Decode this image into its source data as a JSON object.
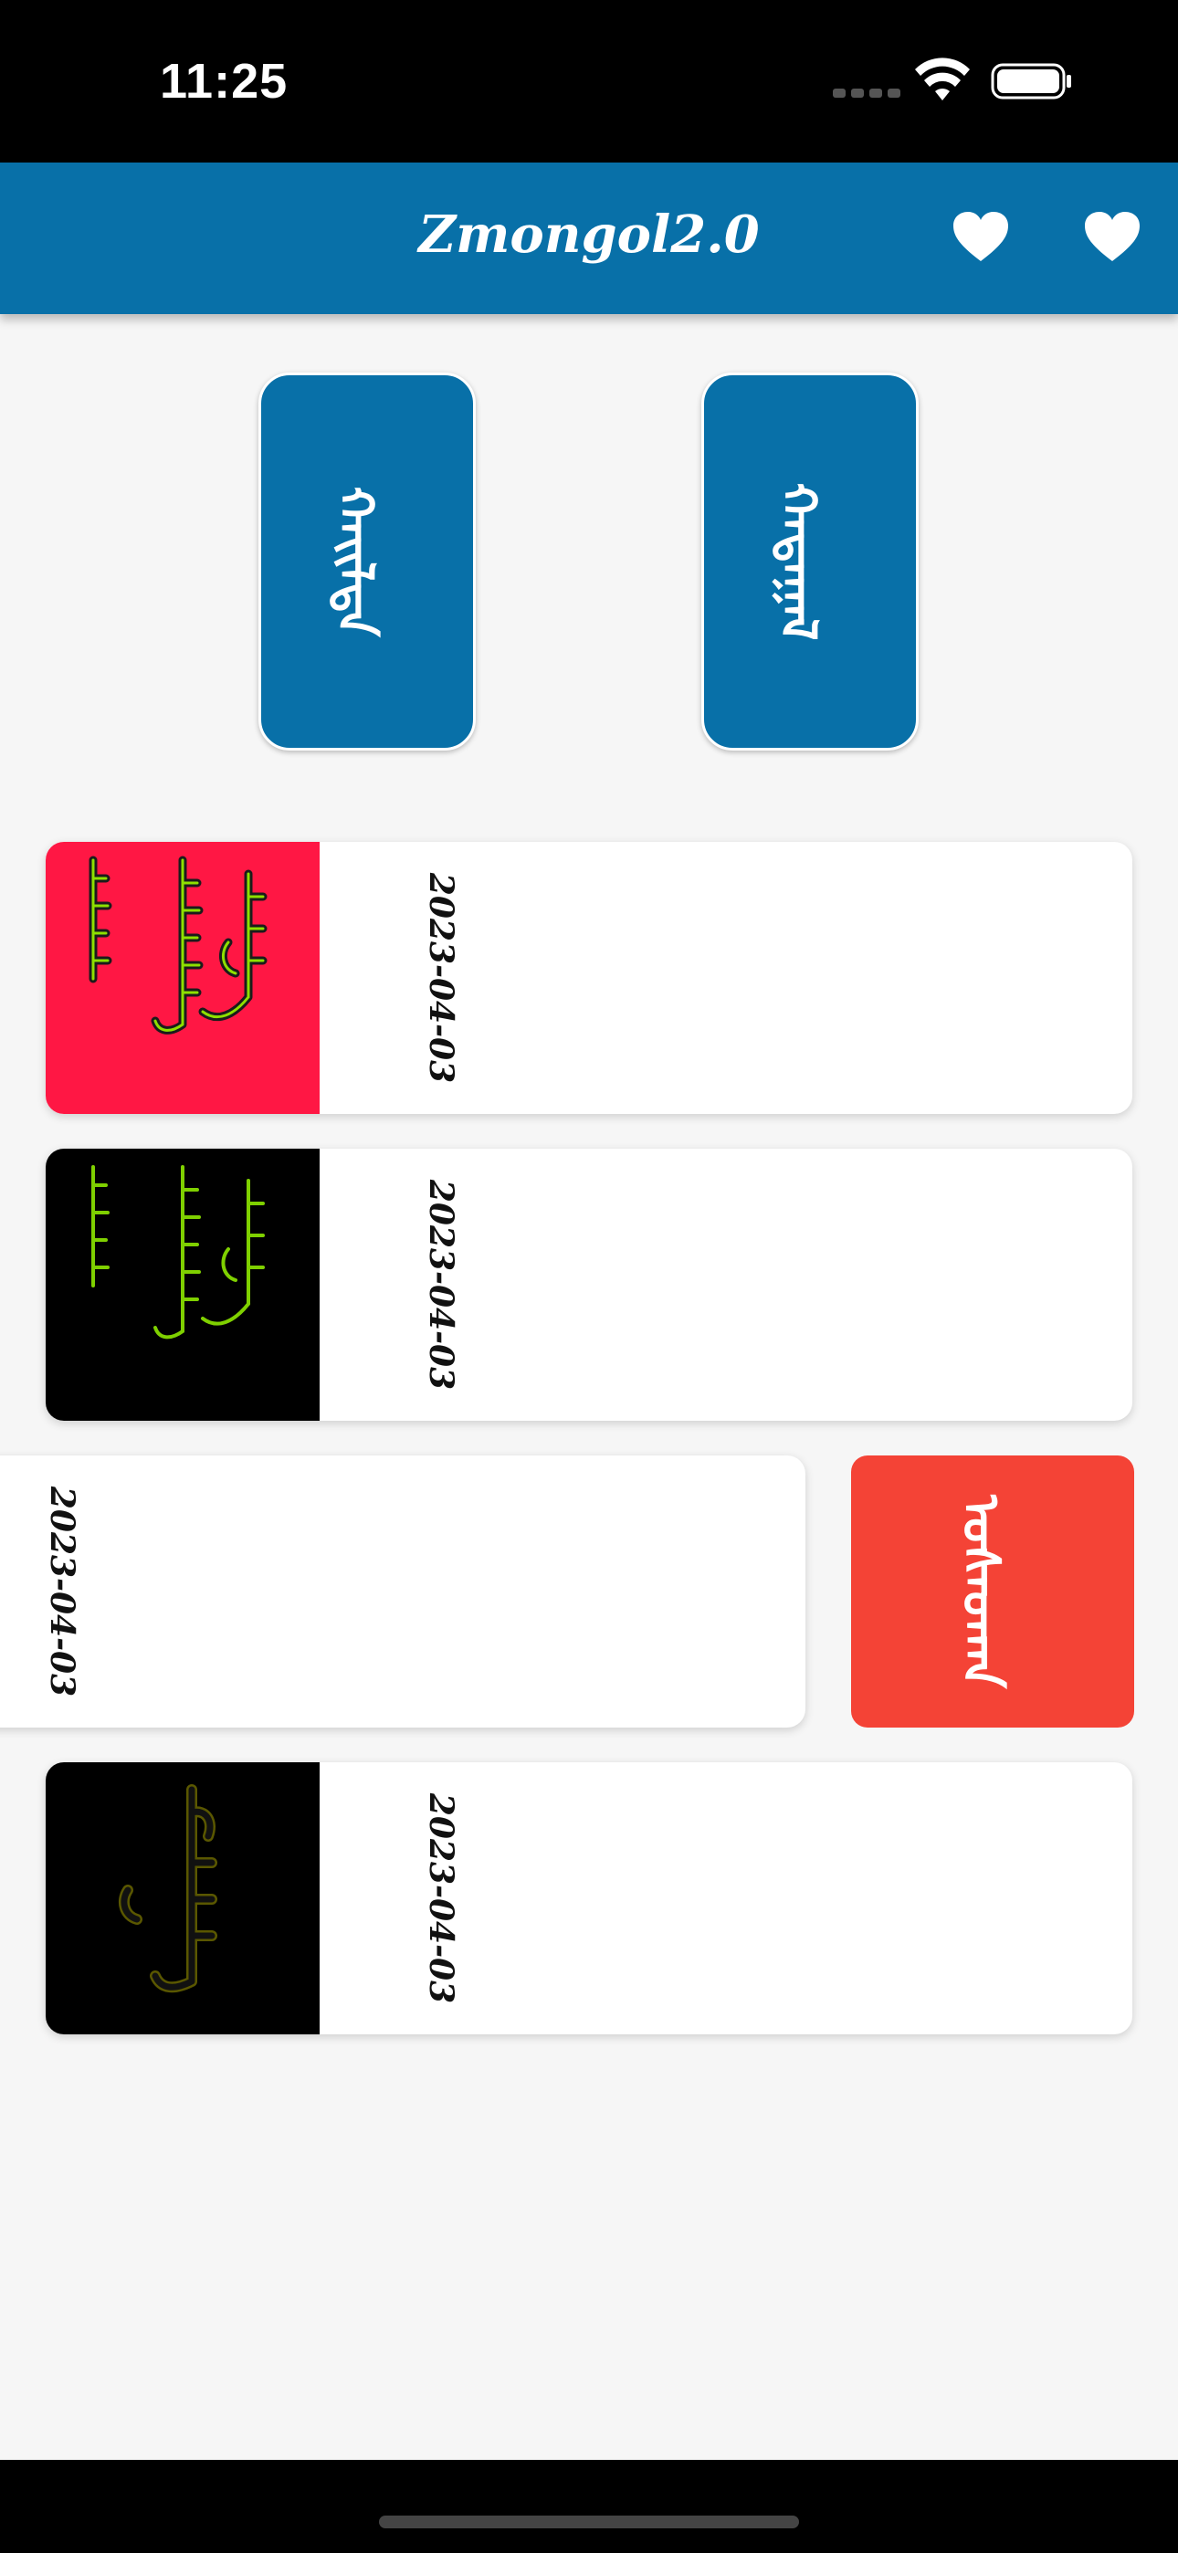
{
  "status_bar": {
    "time": "11:25"
  },
  "app_bar": {
    "title": "Zmongol2.0",
    "icons": [
      "heart-icon",
      "heart-icon"
    ]
  },
  "top_buttons": [
    {
      "label": "ᠬᠠᠢᠯᠲᠠ",
      "color": "#0870a8"
    },
    {
      "label": "ᠬᠠᠳᠠᠭᠠᠯ",
      "color": "#0870a8"
    }
  ],
  "list": [
    {
      "date": "2023-04-03",
      "thumbnail": "red-green-mongolian-text",
      "bg": "#ff1744"
    },
    {
      "date": "2023-04-03",
      "thumbnail": "black-green-mongolian-text",
      "bg": "#000000"
    },
    {
      "date": "2023-04-03",
      "swiped": true
    },
    {
      "date": "2023-04-03",
      "thumbnail": "black-gold-mongolian-text",
      "bg": "#000000"
    }
  ],
  "delete_action": {
    "label": "ᠤᠰᠠᠳᠬᠠ",
    "color": "#f44336"
  }
}
